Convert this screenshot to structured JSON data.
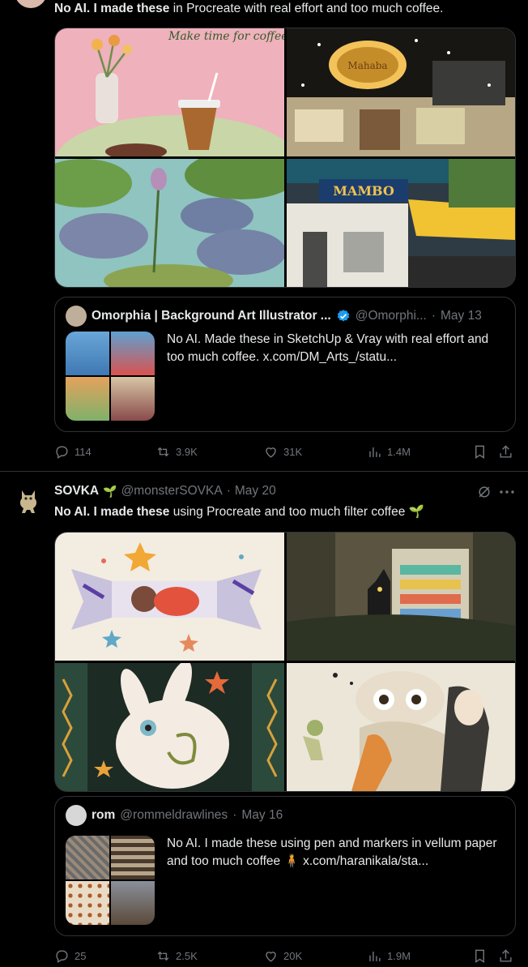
{
  "tweet1": {
    "text_bold": "No AI. I made these",
    "text_rest": " in Procreate with real effort and too much coffee.",
    "images": [
      "coffee-and-cake",
      "cafe-at-night",
      "lily-pond",
      "mambo-street"
    ],
    "image_text_1": "Make time for coffee & cake",
    "image_text_2": "Mahaba",
    "image_text_4": "MAMBO",
    "quote": {
      "name": "Omorphia | Background Art Illustrator ...",
      "handle": "@Omorphi...",
      "sep": "·",
      "date": "May 13",
      "text": "No AI. Made these in SketchUp & Vray with real effort and too much coffee.  x.com/DM_Arts_/statu..."
    },
    "actions": {
      "replies": "114",
      "reposts": "3.9K",
      "likes": "31K",
      "views": "1.4M"
    }
  },
  "tweet2": {
    "name": "SOVKA",
    "emoji": "🌱",
    "handle": "@monsterSOVKA",
    "sep": "·",
    "date": "May 20",
    "text_bold": "No AI. I made these",
    "text_rest": " using Procreate and too much filter coffee ",
    "text_emoji": "🌱",
    "images": [
      "candy-bunny",
      "cat-vending-machine",
      "white-rabbit",
      "cat-and-girl"
    ],
    "quote": {
      "name": "rom",
      "handle": "@rommeldrawlines",
      "sep": "·",
      "date": "May 16",
      "text": "No AI. I made these using pen and markers in vellum paper and too much coffee 🧍 x.com/haranikala/sta..."
    },
    "actions": {
      "replies": "25",
      "reposts": "2.5K",
      "likes": "20K",
      "views": "1.9M"
    }
  },
  "colors": {
    "background": "#000000",
    "text": "#e7e9ea",
    "muted": "#71767b",
    "border": "#2f3336",
    "verified": "#1d9bf0"
  }
}
